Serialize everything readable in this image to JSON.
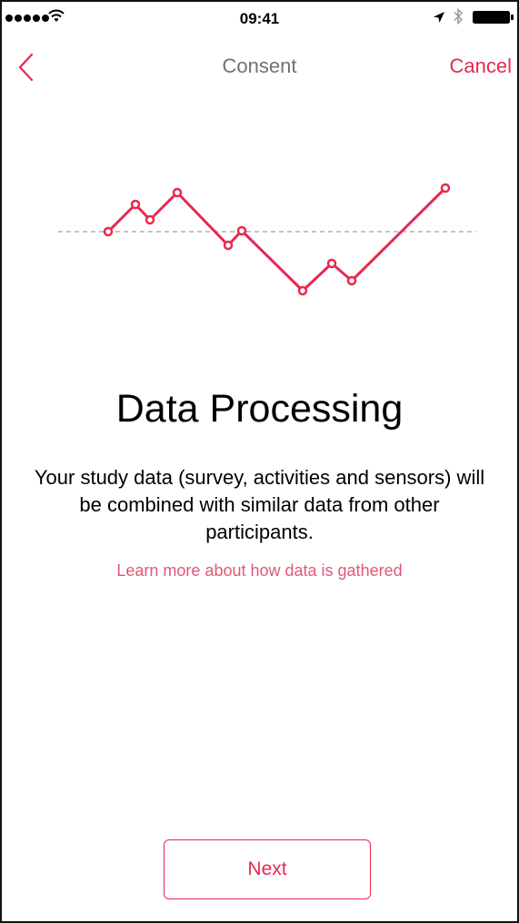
{
  "status_bar": {
    "time": "09:41",
    "signal_bars": 5,
    "wifi_icon": "wifi-icon",
    "location_icon": "location-arrow-icon",
    "bluetooth_icon": "bluetooth-icon",
    "battery_icon": "battery-full-icon"
  },
  "nav": {
    "back_icon": "chevron-left-icon",
    "title": "Consent",
    "cancel_label": "Cancel"
  },
  "illustration": {
    "icon": "data-line-graph-icon",
    "accent_color": "#e8294f"
  },
  "content": {
    "title": "Data Processing",
    "description": "Your study data (survey, activities and sensors) will be combined with similar data from other participants.",
    "learn_more": "Learn more about how data is gathered"
  },
  "footer": {
    "next_label": "Next"
  },
  "colors": {
    "accent": "#e8294f",
    "link": "#e05877",
    "nav_title": "#727272"
  }
}
